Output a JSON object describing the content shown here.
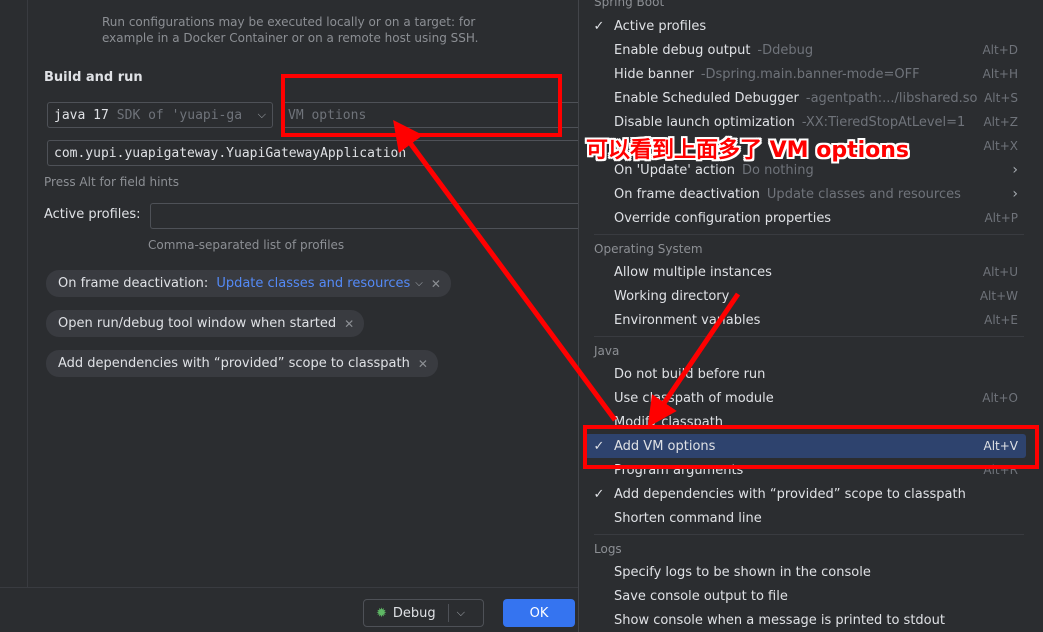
{
  "form": {
    "run_hint_line1": "Run configurations may be executed locally or on a target: for",
    "run_hint_line2": "example in a Docker Container or on a remote host using SSH.",
    "build_and_run_title": "Build and run",
    "jdk_value": "java 17",
    "jdk_detail": "SDK of 'yuapi-ga",
    "vm_options_placeholder": "VM options",
    "main_class_value": "com.yupi.yuapigateway.YuapiGatewayApplication",
    "field_hint": "Press Alt for field hints",
    "active_profiles_label": "Active profiles:",
    "active_profiles_value": "",
    "active_profiles_hint": "Comma-separated list of profiles",
    "frame_deactivation_label": "On frame deactivation:",
    "frame_deactivation_value": "Update classes and resources",
    "open_tool_window_label": "Open run/debug tool window when started",
    "add_dependencies_label": "Add dependencies with “provided” scope to classpath"
  },
  "footer": {
    "debug_label": "Debug",
    "ok_label": "OK"
  },
  "menu": {
    "groups": {
      "spring_boot": "Spring Boot",
      "operating_system": "Operating System",
      "java": "Java",
      "logs": "Logs"
    },
    "items": [
      {
        "label": "Active profiles",
        "arg": "",
        "shortcut": "",
        "checked": true
      },
      {
        "label": "Enable debug output",
        "arg": "-Ddebug",
        "shortcut": "Alt+D",
        "checked": false
      },
      {
        "label": "Hide banner",
        "arg": "-Dspring.main.banner-mode=OFF",
        "shortcut": "Alt+H",
        "checked": false
      },
      {
        "label": "Enable Scheduled Debugger",
        "arg": "-agentpath:.../libshared.so",
        "shortcut": "Alt+S",
        "checked": false
      },
      {
        "label": "Disable launch optimization",
        "arg": "-XX:TieredStopAtLevel=1",
        "shortcut": "Alt+Z",
        "checked": false
      },
      {
        "label": "",
        "arg": "",
        "shortcut": "Alt+X",
        "checked": false
      },
      {
        "label": "On 'Update' action",
        "arg": "Do nothing",
        "shortcut": "›",
        "checked": false
      },
      {
        "label": "On frame deactivation",
        "arg": "Update classes and resources",
        "shortcut": "›",
        "checked": false
      },
      {
        "label": "Override configuration properties",
        "arg": "",
        "shortcut": "Alt+P",
        "checked": false
      },
      {
        "label": "Allow multiple instances",
        "arg": "",
        "shortcut": "Alt+U",
        "checked": false
      },
      {
        "label": "Working directory",
        "arg": "",
        "shortcut": "Alt+W",
        "checked": false
      },
      {
        "label": "Environment variables",
        "arg": "",
        "shortcut": "Alt+E",
        "checked": false
      },
      {
        "label": "Do not build before run",
        "arg": "",
        "shortcut": "",
        "checked": false
      },
      {
        "label": "Use classpath of module",
        "arg": "",
        "shortcut": "Alt+O",
        "checked": false
      },
      {
        "label": "Modify classpath",
        "arg": "",
        "shortcut": "",
        "checked": false
      },
      {
        "label": "Add VM options",
        "arg": "",
        "shortcut": "Alt+V",
        "checked": true
      },
      {
        "label": "Program arguments",
        "arg": "",
        "shortcut": "Alt+R",
        "checked": false
      },
      {
        "label": "Add dependencies with “provided” scope to classpath",
        "arg": "",
        "shortcut": "",
        "checked": true
      },
      {
        "label": "Shorten command line",
        "arg": "",
        "shortcut": "",
        "checked": false
      },
      {
        "label": "Specify logs to be shown in the console",
        "arg": "",
        "shortcut": "",
        "checked": false
      },
      {
        "label": "Save console output to file",
        "arg": "",
        "shortcut": "",
        "checked": false
      },
      {
        "label": "Show console when a message is printed to stdout",
        "arg": "",
        "shortcut": "",
        "checked": false
      }
    ],
    "checkmark": "✓"
  },
  "annotation": {
    "text": "可以看到上面多了 VM options",
    "color": "#ff0000"
  },
  "colors": {
    "accent": "#3574f0",
    "link": "#548af7",
    "selection": "#2e436e",
    "background": "#2b2d30"
  }
}
